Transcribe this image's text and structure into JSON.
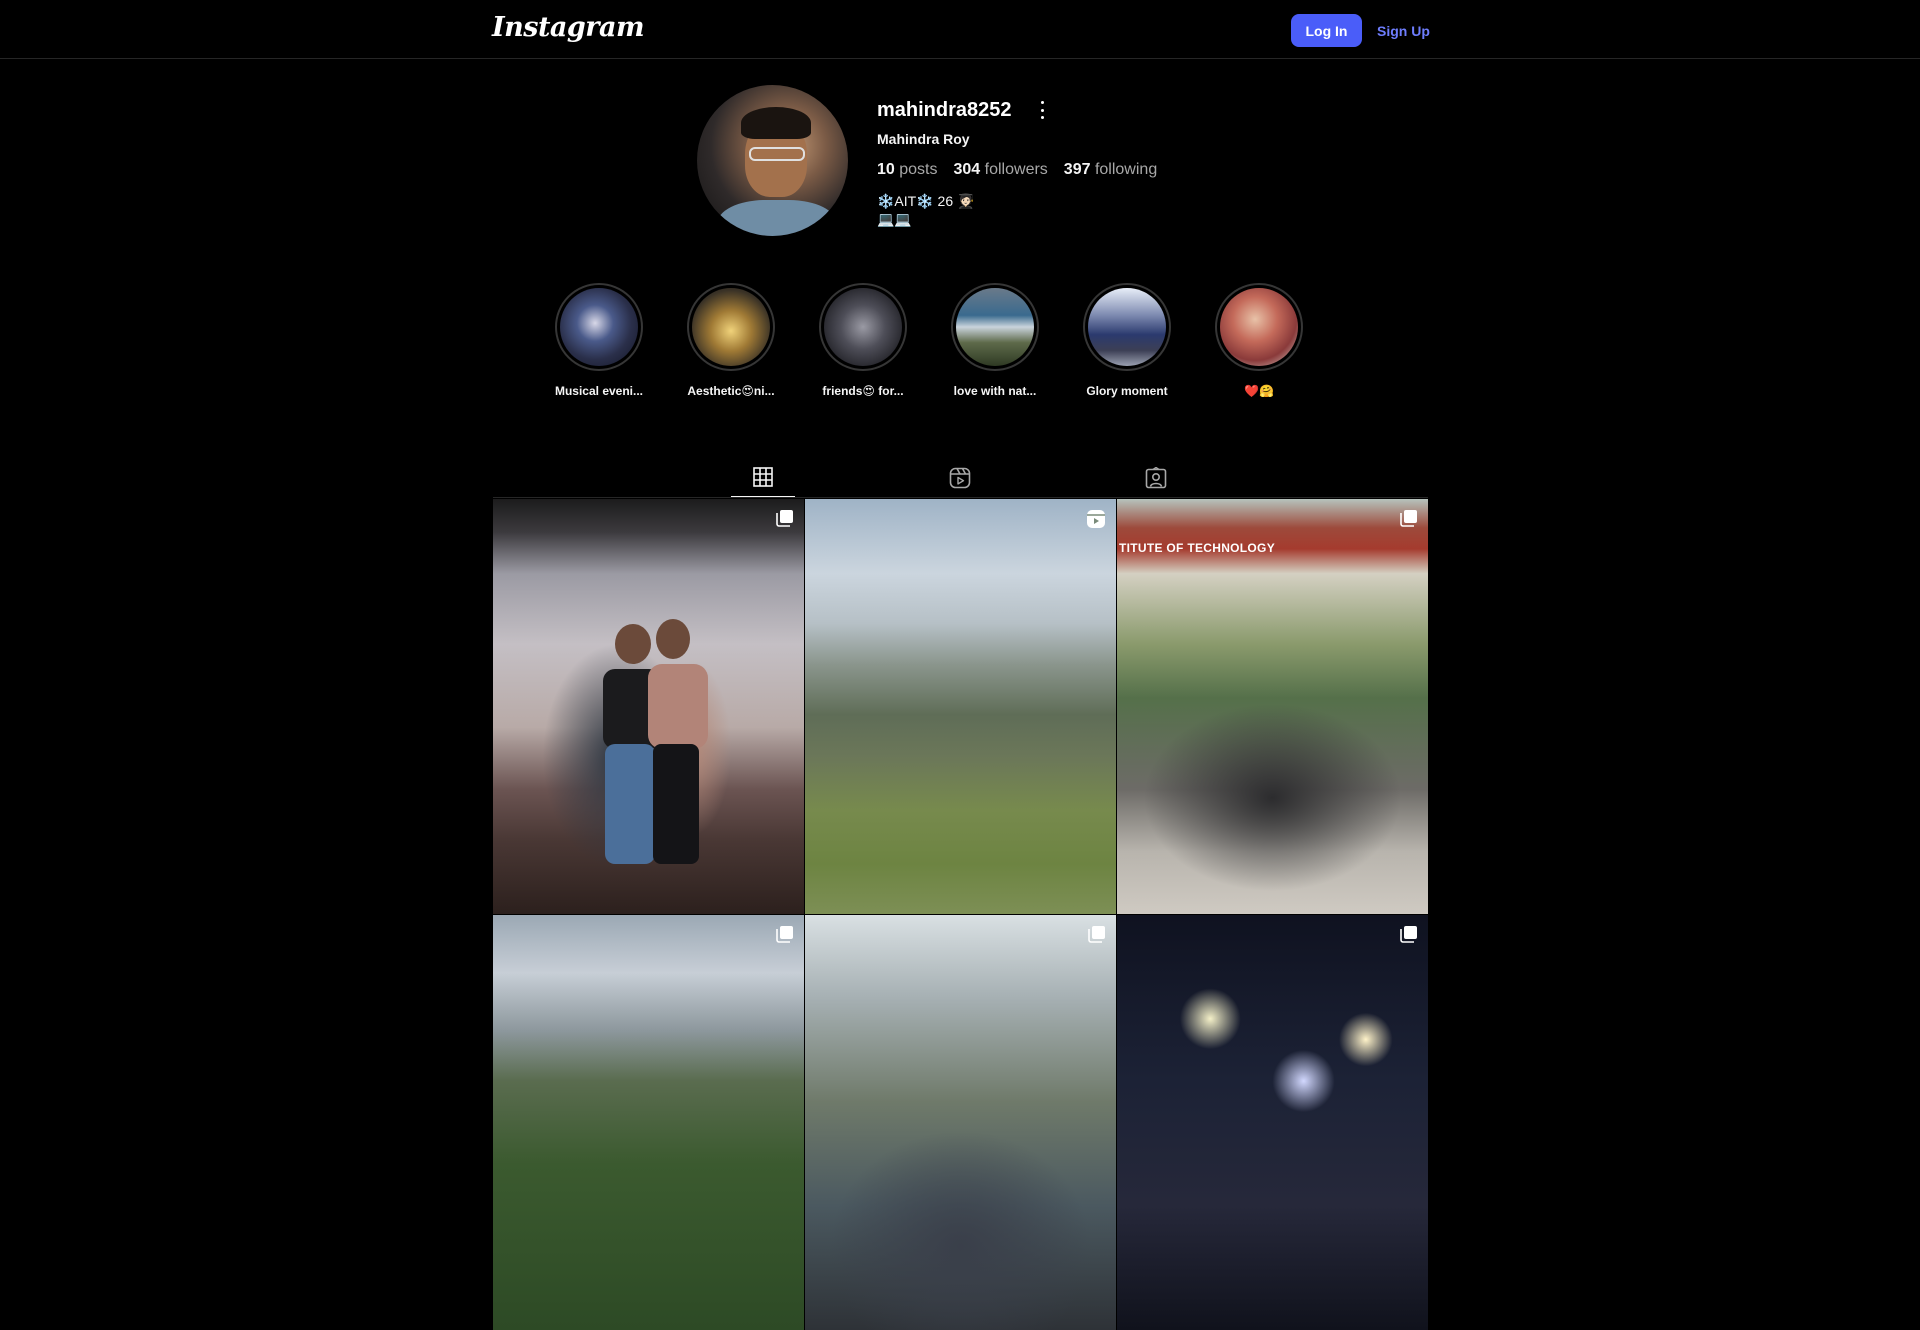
{
  "header": {
    "logo_text": "Instagram",
    "login_label": "Log In",
    "signup_label": "Sign Up"
  },
  "profile": {
    "username": "mahindra8252",
    "full_name": "Mahindra Roy",
    "posts_count": "10",
    "posts_label": "posts",
    "followers_count": "304",
    "followers_label": "followers",
    "following_count": "397",
    "following_label": "following",
    "bio_line1": "❄️AIT❄️ 26 🧑🏻‍🎓",
    "bio_line2": "💻💻"
  },
  "highlights": [
    {
      "label": "Musical eveni..."
    },
    {
      "label": "Aesthetic😍ni..."
    },
    {
      "label": "friends😍 for..."
    },
    {
      "label": "love with nat..."
    },
    {
      "label": "Glory moment"
    },
    {
      "label": "❤️🤗"
    }
  ],
  "tabs": {
    "active": "posts",
    "items": [
      "grid-icon",
      "reels-icon",
      "tagged-icon"
    ]
  },
  "posts": [
    {
      "badge": "carousel-icon",
      "text_in_image": ""
    },
    {
      "badge": "reel-icon",
      "text_in_image": ""
    },
    {
      "badge": "carousel-icon",
      "text_in_image": "TITUTE OF TECHNOLOGY"
    },
    {
      "badge": "carousel-icon",
      "text_in_image": ""
    },
    {
      "badge": "carousel-icon",
      "text_in_image": ""
    },
    {
      "badge": "carousel-icon",
      "text_in_image": ""
    }
  ],
  "colors": {
    "background": "#000000",
    "primary_button": "#4a5df9",
    "link": "#6e7dfd",
    "secondary_text": "#a8a8a8"
  }
}
